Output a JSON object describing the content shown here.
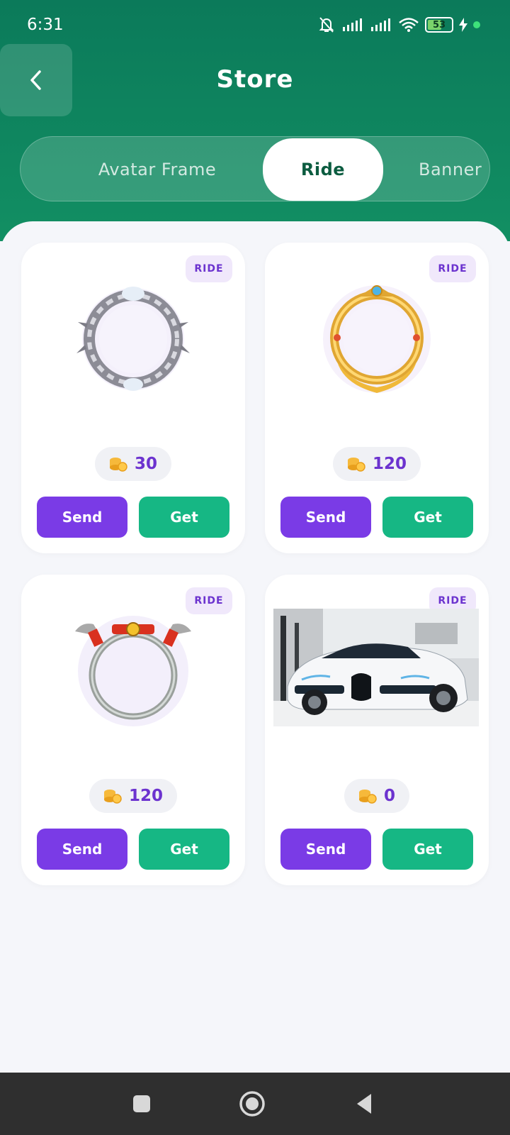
{
  "status_bar": {
    "time": "6:31",
    "battery": "53"
  },
  "header": {
    "title": "Store"
  },
  "tabs": [
    {
      "label": "Avatar Frame",
      "active": false
    },
    {
      "label": "Ride",
      "active": true
    },
    {
      "label": "Banner",
      "active": false
    }
  ],
  "products": [
    {
      "badge": "RIDE",
      "price": "30",
      "art": "silver-wreath-frame",
      "send_label": "Send",
      "get_label": "Get"
    },
    {
      "badge": "RIDE",
      "price": "120",
      "art": "gold-winged-frame",
      "send_label": "Send",
      "get_label": "Get"
    },
    {
      "badge": "RIDE",
      "price": "120",
      "art": "dragon-ring-frame",
      "send_label": "Send",
      "get_label": "Get"
    },
    {
      "badge": "RIDE",
      "price": "0",
      "art": "white-sports-car-photo",
      "send_label": "Send",
      "get_label": "Get"
    }
  ],
  "colors": {
    "header": "#0b7a5a",
    "accent_purple": "#7a3be6",
    "accent_green": "#16b784",
    "price_text": "#6c33cf"
  },
  "system_nav": [
    "recent-apps-icon",
    "home-icon",
    "back-triangle-icon"
  ]
}
